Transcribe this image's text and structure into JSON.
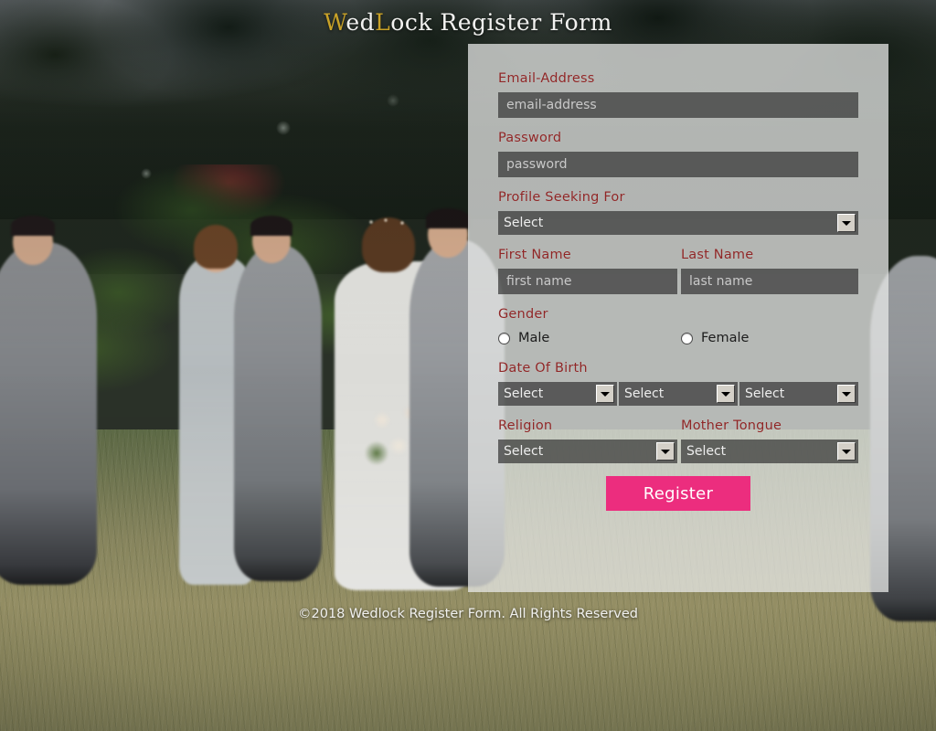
{
  "header": {
    "title_prefix": "W",
    "title_mid1": "ed",
    "title_gold2": "L",
    "title_rest": "ock Register Form",
    "title_full": "WedLock Register Form",
    "gold_color": "#c9a227"
  },
  "form": {
    "email": {
      "label": "Email-Address",
      "placeholder": "email-address",
      "value": ""
    },
    "password": {
      "label": "Password",
      "placeholder": "password",
      "value": ""
    },
    "profile_seeking": {
      "label": "Profile Seeking For",
      "selected": "Select"
    },
    "first_name": {
      "label": "First Name",
      "placeholder": "first name",
      "value": ""
    },
    "last_name": {
      "label": "Last Name",
      "placeholder": "last name",
      "value": ""
    },
    "gender": {
      "label": "Gender",
      "options": [
        {
          "label": "Male",
          "checked": false
        },
        {
          "label": "Female",
          "checked": false
        }
      ]
    },
    "date_of_birth": {
      "label": "Date Of Birth",
      "day": "Select",
      "month": "Select",
      "year": "Select"
    },
    "religion": {
      "label": "Religion",
      "selected": "Select"
    },
    "mother_tongue": {
      "label": "Mother Tongue",
      "selected": "Select"
    },
    "submit_label": "Register",
    "accent_color": "#ec2d7e",
    "label_color": "#8f2626"
  },
  "footer": {
    "text": "©2018 Wedlock Register Form. All Rights Reserved"
  }
}
